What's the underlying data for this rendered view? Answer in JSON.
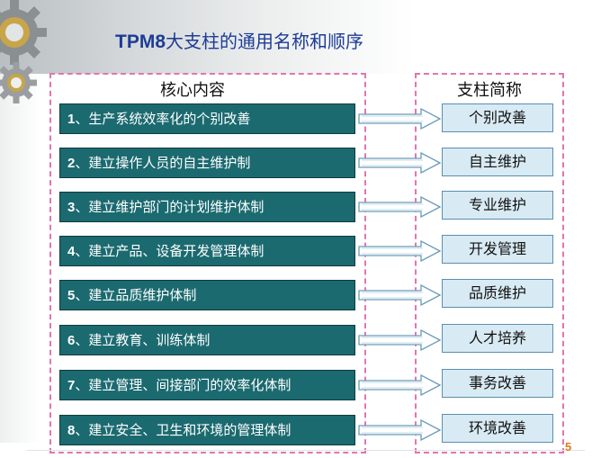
{
  "slide": {
    "title_bold": "TPM8",
    "title_rest": "大支柱的通用名称和顺序",
    "page_number": "5"
  },
  "columns": {
    "left_header": "核心内容",
    "right_header": "支柱简称"
  },
  "items": [
    {
      "num": "1",
      "text": "、生产系统效率化的个别改善",
      "abbr": "个别改善"
    },
    {
      "num": "2",
      "text": "、建立操作人员的自主维护制",
      "abbr": "自主维护"
    },
    {
      "num": "3",
      "text": "、建立维护部门的计划维护体制",
      "abbr": "专业维护"
    },
    {
      "num": "4",
      "text": "、建立产品、设备开发管理体制",
      "abbr": "开发管理"
    },
    {
      "num": "5",
      "text": "、建立品质维护体制",
      "abbr": "品质维护"
    },
    {
      "num": "6",
      "text": "、建立教育、训练体制",
      "abbr": "人才培养"
    },
    {
      "num": "7",
      "text": "、建立管理、间接部门的效率化体制",
      "abbr": "事务改善"
    },
    {
      "num": "8",
      "text": "、建立安全、卫生和环境的管理体制",
      "abbr": "环境改善"
    }
  ],
  "colors": {
    "item_fill": "#1b6a70",
    "abbr_fill": "#d8eaf3",
    "dash_border": "#e275b0",
    "title_color": "#1d3c96"
  },
  "icons": [
    "gear-large-icon",
    "gear-small-icon",
    "arrow-icon"
  ]
}
